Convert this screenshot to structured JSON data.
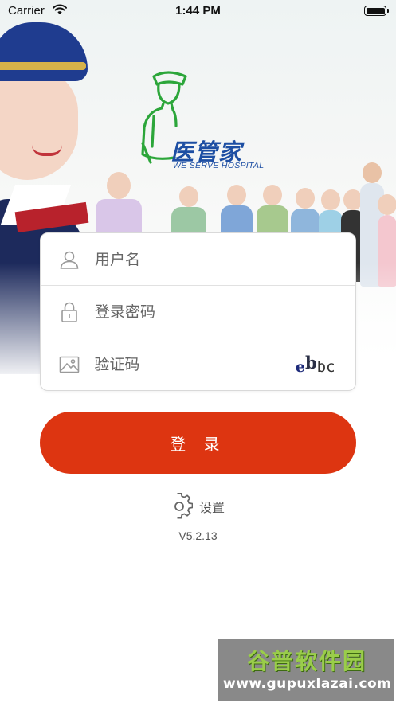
{
  "status_bar": {
    "carrier": "Carrier",
    "time": "1:44 PM"
  },
  "logo": {
    "name": "医管家",
    "tagline": "WE SERVE HOSPITAL"
  },
  "login_form": {
    "username_placeholder": "用户名",
    "password_placeholder": "登录密码",
    "captcha_placeholder": "验证码",
    "captcha_chars": [
      "e",
      "b",
      "b",
      "c"
    ]
  },
  "login_button": {
    "label": "登 录"
  },
  "settings": {
    "label": "设置"
  },
  "version": "V5.2.13",
  "watermark": {
    "title": "谷普软件园",
    "url": "www.gupuxlazai.com"
  },
  "colors": {
    "primary_button": "#dd3511",
    "logo_blue": "#1d4ea3",
    "logo_green": "#2ca63a"
  }
}
